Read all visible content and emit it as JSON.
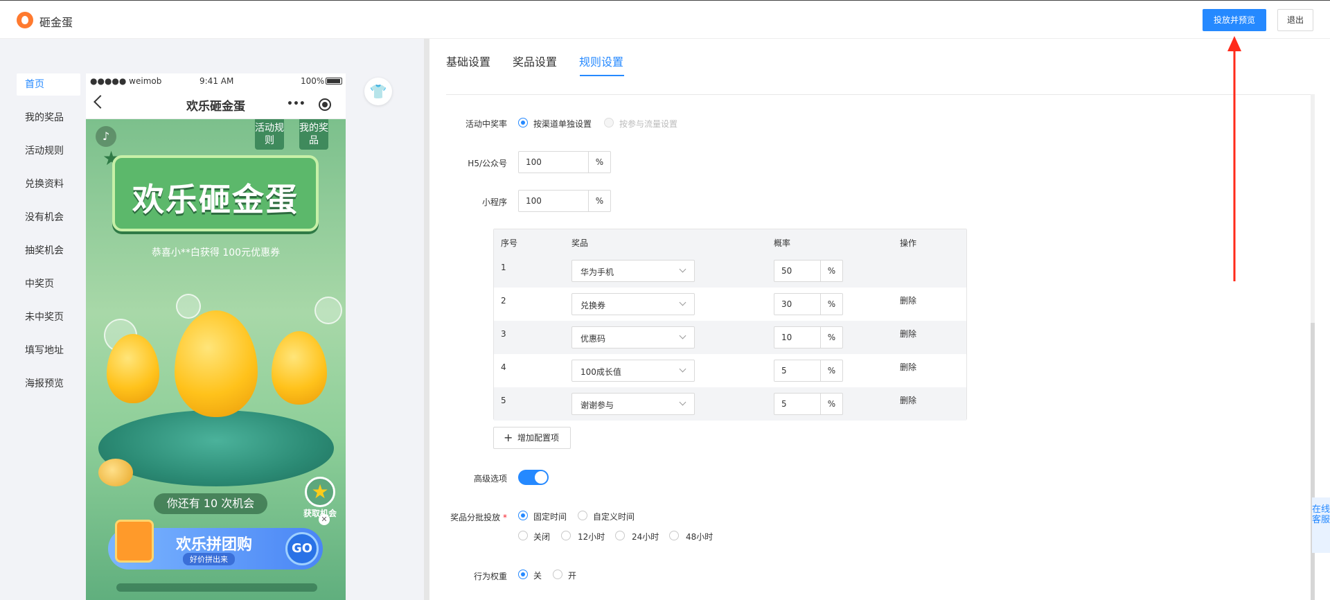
{
  "header": {
    "app_title": "砸金蛋",
    "preview_button": "投放并预览",
    "exit_button": "退出"
  },
  "sidebar": {
    "items": [
      {
        "label": "首页",
        "active": true
      },
      {
        "label": "我的奖品"
      },
      {
        "label": "活动规则"
      },
      {
        "label": "兑换资料"
      },
      {
        "label": "没有机会"
      },
      {
        "label": "抽奖机会"
      },
      {
        "label": "中奖页"
      },
      {
        "label": "未中奖页"
      },
      {
        "label": "填写地址"
      },
      {
        "label": "海报预览"
      }
    ]
  },
  "phone": {
    "status": {
      "carrier": "●●●●● weimob",
      "time": "9:41 AM",
      "battery": "100%"
    },
    "nav_title": "欢乐砸金蛋",
    "nav_more": "•••",
    "game": {
      "rules_btn": "活动规则",
      "prizes_btn": "我的奖品",
      "banner_title": "欢乐砸金蛋",
      "congrats": "恭喜小**白获得 100元优惠券",
      "chances": "你还有 10 次机会",
      "get_more": "获取机会",
      "promo_title": "欢乐拼团购",
      "promo_sub": "好价拼出来",
      "promo_go": "GO",
      "music_icon": "♪",
      "close_icon": "✕",
      "star_icon": "★"
    }
  },
  "skin_icon": "👕",
  "tabs": [
    {
      "label": "基础设置"
    },
    {
      "label": "奖品设置"
    },
    {
      "label": "规则设置",
      "active": true
    }
  ],
  "form": {
    "win_rate": {
      "label": "活动中奖率",
      "options": [
        {
          "label": "按渠道单独设置",
          "checked": true
        },
        {
          "label": "按参与流量设置",
          "disabled": true
        }
      ]
    },
    "h5": {
      "label": "H5/公众号",
      "value": "100",
      "unit": "%"
    },
    "mini": {
      "label": "小程序",
      "value": "100",
      "unit": "%"
    },
    "table": {
      "headers": [
        "序号",
        "奖品",
        "概率",
        "操作"
      ],
      "rows": [
        {
          "no": "1",
          "prize": "华为手机",
          "prob": "50",
          "unit": "%",
          "action": ""
        },
        {
          "no": "2",
          "prize": "兑换券",
          "prob": "30",
          "unit": "%",
          "action": "删除"
        },
        {
          "no": "3",
          "prize": "优惠码",
          "prob": "10",
          "unit": "%",
          "action": "删除"
        },
        {
          "no": "4",
          "prize": "100成长值",
          "prob": "5",
          "unit": "%",
          "action": "删除"
        },
        {
          "no": "5",
          "prize": "谢谢参与",
          "prob": "5",
          "unit": "%",
          "action": "删除"
        }
      ]
    },
    "add_button": "增加配置项",
    "advanced": {
      "label": "高级选项",
      "on": true
    },
    "batch": {
      "label": "奖品分批投放",
      "required_mark": "*",
      "mode_options": [
        {
          "label": "固定时间",
          "checked": true
        },
        {
          "label": "自定义时间"
        }
      ],
      "interval_options": [
        {
          "label": "关闭"
        },
        {
          "label": "12小时"
        },
        {
          "label": "24小时"
        },
        {
          "label": "48小时"
        }
      ]
    },
    "weight": {
      "label": "行为权重",
      "options": [
        {
          "label": "关",
          "checked": true
        },
        {
          "label": "开"
        }
      ]
    }
  },
  "service_tab": "在线客服",
  "colors": {
    "accent": "#2589ff",
    "annotation": "#ff2a1a"
  }
}
